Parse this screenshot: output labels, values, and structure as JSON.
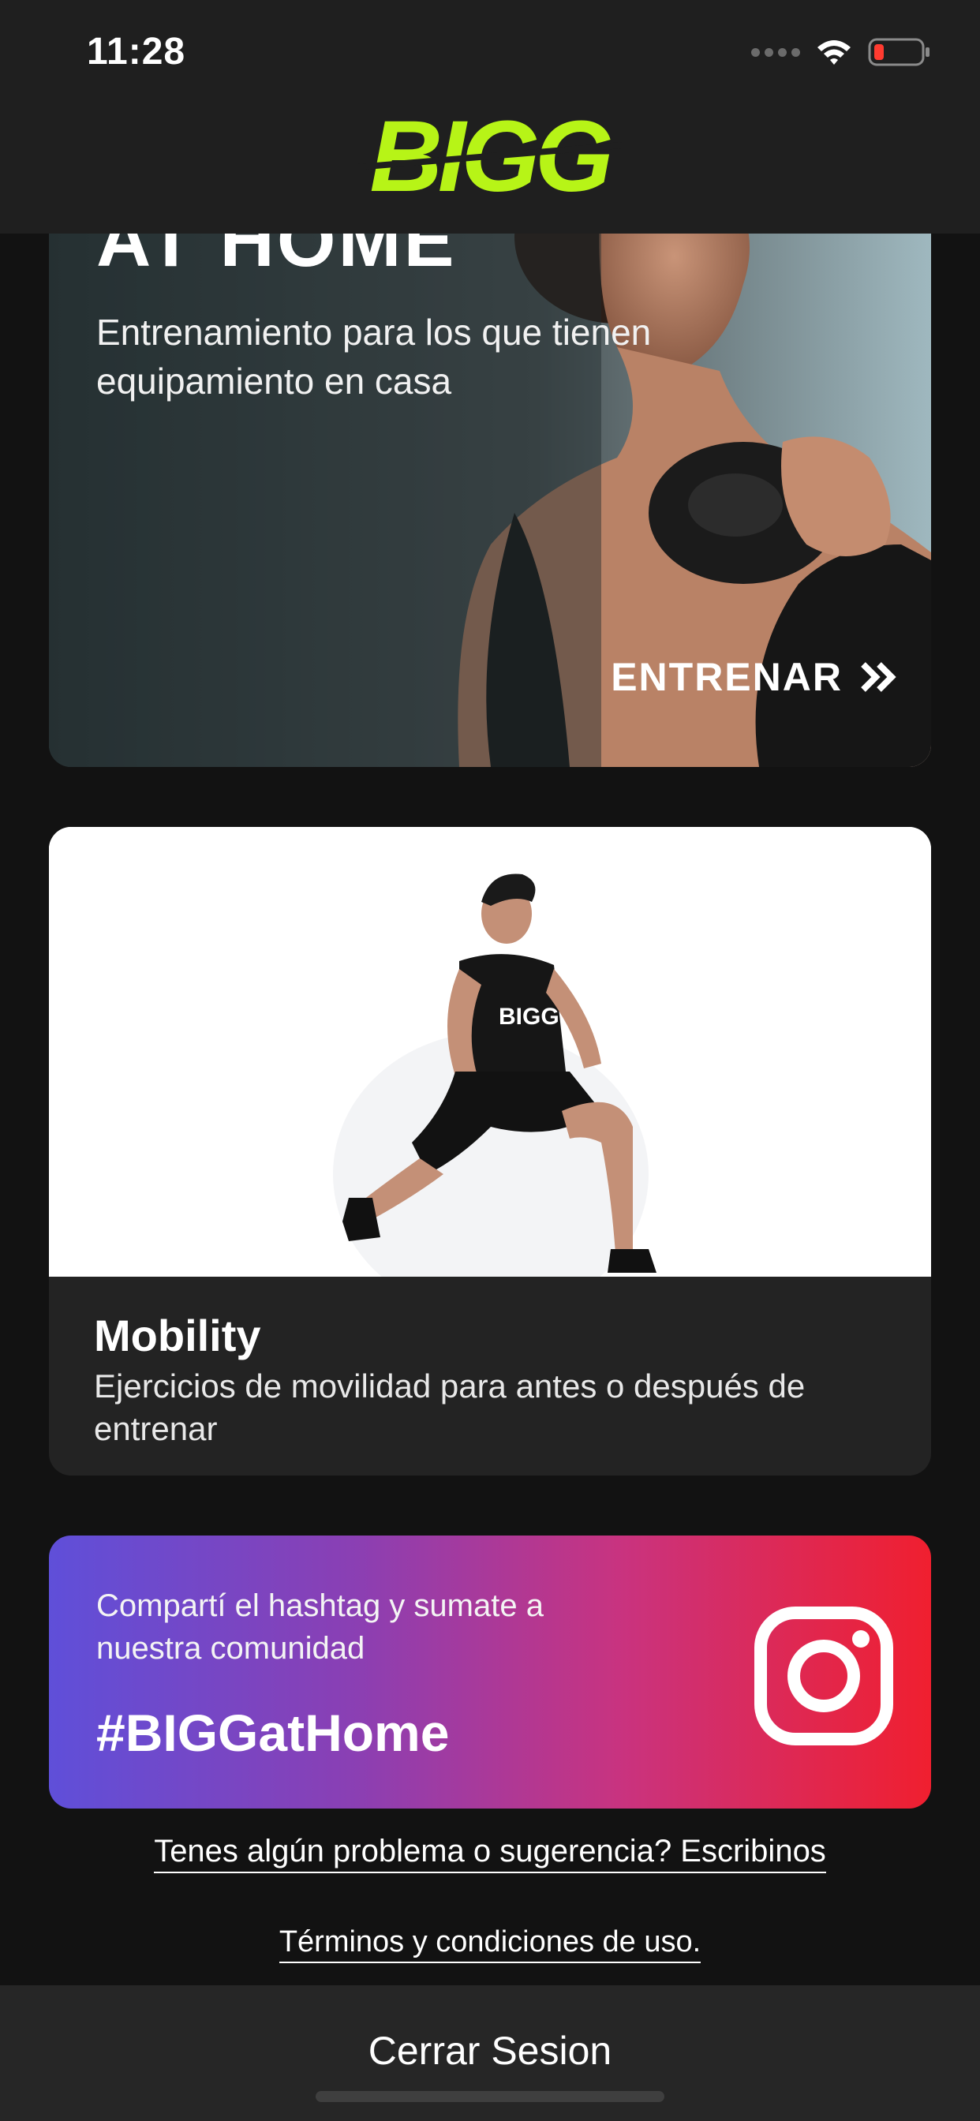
{
  "status_bar": {
    "time": "11:28"
  },
  "header": {
    "logo_text": "BIGG",
    "brand_color": "#b7f417"
  },
  "athome_card": {
    "title": "AT HOME",
    "subtitle": "Entrenamiento para los que tienen equipamiento en casa",
    "cta_label": "ENTRENAR",
    "cta_icon": "double-chevron-right-icon"
  },
  "mobility_card": {
    "title": "Mobility",
    "subtitle": "Ejercicios de movilidad para antes o después de entrenar",
    "shirt_logo": "BIGG"
  },
  "instagram_card": {
    "text": "Compartí el hashtag y sumate a nuestra comunidad",
    "hashtag": "#BIGGatHome",
    "icon": "instagram-icon"
  },
  "links": {
    "feedback": "Tenes algún problema o sugerencia? Escribinos",
    "terms": "Términos y condiciones de uso."
  },
  "bottom_bar": {
    "logout_label": "Cerrar Sesion"
  }
}
